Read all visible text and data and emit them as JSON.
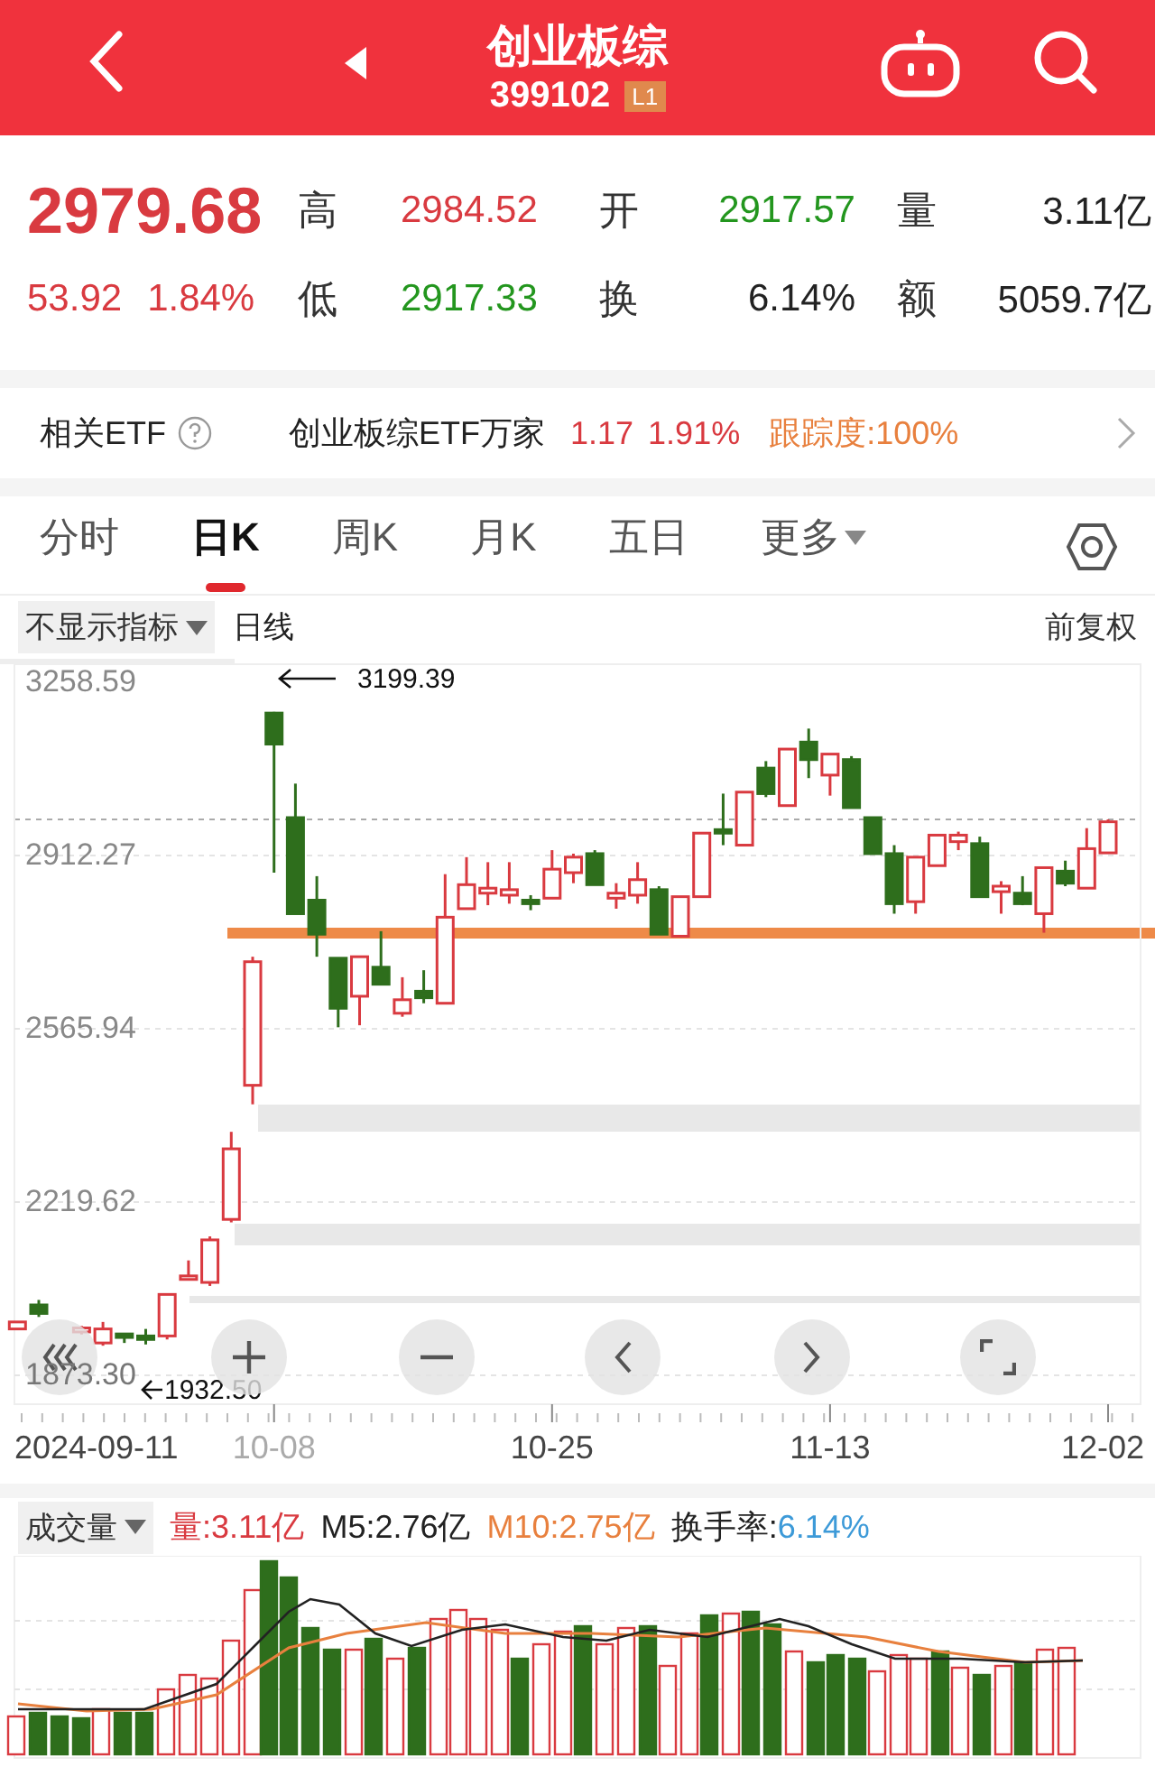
{
  "header": {
    "title": "创业板综",
    "code": "399102",
    "level_badge": "L1"
  },
  "quote": {
    "price": "2979.68",
    "change": "53.92",
    "change_pct": "1.84%",
    "color": "#d93a40",
    "stats": [
      {
        "label": "高",
        "value": "2984.52",
        "color": "#d93a40"
      },
      {
        "label": "开",
        "value": "2917.57",
        "color": "#23961e"
      },
      {
        "label": "量",
        "value": "3.11亿",
        "color": "#222222"
      },
      {
        "label": "低",
        "value": "2917.33",
        "color": "#23961e"
      },
      {
        "label": "换",
        "value": "6.14%",
        "color": "#222222"
      },
      {
        "label": "额",
        "value": "5059.7亿",
        "color": "#222222"
      }
    ]
  },
  "etf": {
    "label": "相关ETF",
    "name": "创业板综ETF万家",
    "price": "1.17",
    "change_pct": "1.91%",
    "tracking": "跟踪度:100%"
  },
  "tabs": [
    {
      "label": "分时",
      "selected": false,
      "menu": false
    },
    {
      "label": "日K",
      "selected": true,
      "menu": false
    },
    {
      "label": "周K",
      "selected": false,
      "menu": false
    },
    {
      "label": "月K",
      "selected": false,
      "menu": false
    },
    {
      "label": "五日",
      "selected": false,
      "menu": false
    },
    {
      "label": "更多",
      "selected": false,
      "menu": true
    }
  ],
  "indicator": {
    "selector": "不显示指标",
    "period": "日线",
    "adjust": "前复权"
  },
  "chart": {
    "annotations": {
      "high": "3199.39",
      "low": "1932.50"
    },
    "chart_data": {
      "type": "candlestick",
      "categories": [
        null,
        null,
        null,
        null,
        null,
        null,
        null,
        null,
        null,
        null,
        null,
        null,
        "10-08",
        null,
        null,
        null,
        null,
        null,
        null,
        null,
        null,
        null,
        null,
        null,
        null,
        "10-25",
        null,
        null,
        null,
        null,
        null,
        null,
        null,
        null,
        null,
        null,
        null,
        null,
        "11-13",
        null,
        null,
        null,
        null,
        null,
        null,
        null,
        null,
        null,
        null,
        null,
        null,
        "12-02"
      ],
      "ylim": [
        1815.6,
        3294.7
      ],
      "grid": true,
      "ohlc": [
        [
          1966,
          1980,
          1966,
          1980
        ],
        [
          2014,
          2024,
          1990,
          1997
        ],
        null,
        [
          1960,
          1972,
          1955,
          1968
        ],
        [
          1938,
          1980,
          1932.5,
          1966
        ],
        [
          1956,
          1956,
          1938,
          1949
        ],
        [
          1952,
          1966,
          1935,
          1945
        ],
        [
          1952,
          2035,
          1945,
          2035
        ],
        [
          2065,
          2103,
          2065,
          2072
        ],
        [
          2059,
          2151,
          2052,
          2144
        ],
        [
          2185,
          2360,
          2179,
          2326
        ],
        [
          2453,
          2710,
          2415,
          2700
        ],
        [
          3197,
          3199.39,
          2878,
          3135
        ],
        [
          2988,
          3056,
          2796,
          2796
        ],
        [
          2823,
          2871,
          2710,
          2755
        ],
        [
          2707,
          2707,
          2569,
          2607
        ],
        [
          2631,
          2710,
          2573,
          2710
        ],
        [
          2689,
          2761,
          2655,
          2655
        ],
        [
          2597,
          2669,
          2590,
          2624
        ],
        [
          2641,
          2683,
          2617,
          2628
        ],
        [
          2617,
          2875,
          2617,
          2789
        ],
        [
          2806,
          2909,
          2806,
          2854
        ],
        [
          2837,
          2899,
          2813,
          2847
        ],
        [
          2833,
          2899,
          2816,
          2844
        ],
        [
          2823,
          2833,
          2803,
          2816
        ],
        [
          2827,
          2923,
          2827,
          2885
        ],
        [
          2878,
          2916,
          2857,
          2909
        ],
        [
          2916,
          2923,
          2854,
          2854
        ],
        [
          2827,
          2857,
          2806,
          2837
        ],
        [
          2833,
          2899,
          2816,
          2864
        ],
        [
          2844,
          2851,
          2755,
          2755
        ],
        [
          2751,
          2830,
          2751,
          2830
        ],
        [
          2830,
          2957,
          2830,
          2957
        ],
        [
          2964,
          3036,
          2933,
          2957
        ],
        [
          2933,
          3039,
          2933,
          3039
        ],
        [
          3087,
          3101,
          3029,
          3036
        ],
        [
          3012,
          3125,
          3012,
          3125
        ],
        [
          3139,
          3166,
          3067,
          3104
        ],
        [
          3073,
          3115,
          3032,
          3115
        ],
        [
          3104,
          3111,
          3008,
          3008
        ],
        [
          2988,
          2988,
          2916,
          2916
        ],
        [
          2916,
          2933,
          2796,
          2816
        ],
        [
          2820,
          2909,
          2796,
          2909
        ],
        [
          2892,
          2953,
          2892,
          2953
        ],
        [
          2940,
          2960,
          2923,
          2953
        ],
        [
          2936,
          2950,
          2830,
          2830
        ],
        [
          2840,
          2861,
          2796,
          2851
        ],
        [
          2837,
          2871,
          2813,
          2816
        ],
        [
          2796,
          2888,
          2758,
          2888
        ],
        [
          2881,
          2902,
          2851,
          2857
        ],
        [
          2847,
          2967,
          2847,
          2926
        ],
        [
          2917.57,
          2984.52,
          2917.33,
          2979.68
        ]
      ],
      "yticks": [
        {
          "value": 3258.59,
          "label": "3258.59"
        },
        {
          "value": 2912.27,
          "label": "2912.27"
        },
        {
          "value": 2565.94,
          "label": "2565.94"
        },
        {
          "value": 2219.62,
          "label": "2219.62"
        },
        {
          "value": 1873.3,
          "label": "1873.30"
        }
      ]
    },
    "start_date": "2024-09-11",
    "date_labels": [
      {
        "dimmed": true
      },
      {
        "dimmed": false
      },
      {
        "dimmed": false
      },
      {
        "dimmed": false
      }
    ]
  },
  "volume": {
    "selector": "成交量",
    "items": [
      {
        "text": "量:3.11亿",
        "color": "#d93a40",
        "kind": "label"
      },
      {
        "text": "M5:2.76亿",
        "color": "#222222",
        "kind": "label"
      },
      {
        "text": "M10:2.75亿",
        "color": "#e8803e",
        "kind": "label"
      },
      {
        "text": "换手率:",
        "color": "#222222",
        "kind": "label"
      },
      {
        "text": "6.14%",
        "color": "#3d9ad8",
        "kind": "value"
      }
    ]
  }
}
